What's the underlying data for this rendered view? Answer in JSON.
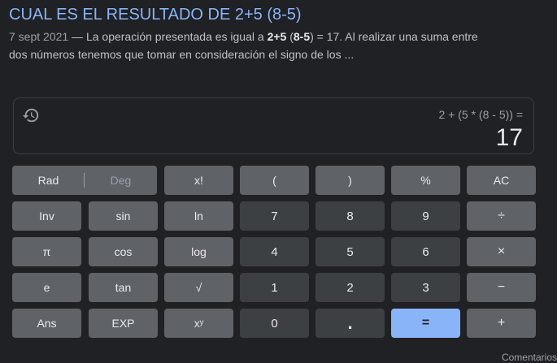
{
  "search_result": {
    "title": "CUAL ES EL RESULTADO DE 2+5 (8-5)",
    "date": "7 sept 2021",
    "dash": " — ",
    "snippet_part1": "La operación presentada es igual a ",
    "snippet_bold1": "2+5",
    "snippet_part2": " (",
    "snippet_bold2": "8-5",
    "snippet_part3": ") = 17. Al realizar una suma entre dos números tenemos que tomar en consideración el signo de los ..."
  },
  "calculator": {
    "history_icon": "history-icon",
    "expression": "2 + (5 * (8 - 5)) =",
    "result": "17",
    "keys": {
      "rad": "Rad",
      "deg": "Deg",
      "factorial": "x!",
      "open_paren": "(",
      "close_paren": ")",
      "percent": "%",
      "clear": "AC",
      "inv": "Inv",
      "sin": "sin",
      "ln": "ln",
      "seven": "7",
      "eight": "8",
      "nine": "9",
      "divide": "÷",
      "pi": "π",
      "cos": "cos",
      "log": "log",
      "four": "4",
      "five": "5",
      "six": "6",
      "multiply": "×",
      "e": "e",
      "tan": "tan",
      "sqrt": "√",
      "one": "1",
      "two": "2",
      "three": "3",
      "minus": "−",
      "ans": "Ans",
      "exp": "EXP",
      "power": "xʸ",
      "zero": "0",
      "decimal": ".",
      "equals": "=",
      "plus": "+"
    }
  },
  "footer": {
    "hint": "Comentarios"
  },
  "colors": {
    "background": "#202124",
    "link": "#8ab4f8",
    "function_key": "#5f6368",
    "number_key": "#3c4043",
    "equals_key": "#8ab4f8"
  }
}
